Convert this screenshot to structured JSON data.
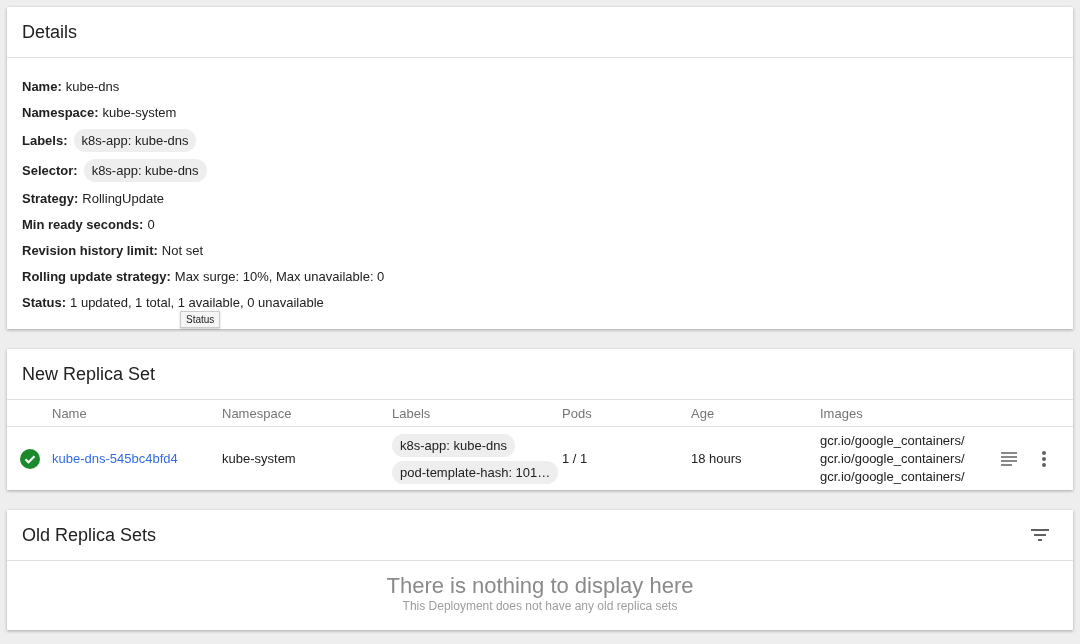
{
  "details": {
    "title": "Details",
    "fields": [
      {
        "label": "Name:",
        "value": "kube-dns"
      },
      {
        "label": "Namespace:",
        "value": "kube-system"
      },
      {
        "label": "Labels:",
        "chips": [
          "k8s-app: kube-dns"
        ]
      },
      {
        "label": "Selector:",
        "chips": [
          "k8s-app: kube-dns"
        ]
      },
      {
        "label": "Strategy:",
        "value": "RollingUpdate"
      },
      {
        "label": "Min ready seconds:",
        "value": "0"
      },
      {
        "label": "Revision history limit:",
        "value": "Not set"
      },
      {
        "label": "Rolling update strategy:",
        "value": "Max surge: 10%, Max unavailable: 0"
      },
      {
        "label": "Status:",
        "value": "1 updated, 1 total, 1 available, 0 unavailable",
        "tooltip": "Status"
      }
    ]
  },
  "new_replica_set": {
    "title": "New Replica Set",
    "columns": [
      "Name",
      "Namespace",
      "Labels",
      "Pods",
      "Age",
      "Images"
    ],
    "rows": [
      {
        "healthy": true,
        "name": "kube-dns-545bc4bfd4",
        "namespace": "kube-system",
        "labels": [
          "k8s-app: kube-dns",
          "pod-template-hash: 101…"
        ],
        "pods": "1 / 1",
        "age": "18 hours",
        "images": [
          "gcr.io/google_containers/",
          "gcr.io/google_containers/",
          "gcr.io/google_containers/"
        ]
      }
    ]
  },
  "old_replica_sets": {
    "title": "Old Replica Sets",
    "empty_title": "There is nothing to display here",
    "empty_subtitle": "This Deployment does not have any old replica sets"
  }
}
